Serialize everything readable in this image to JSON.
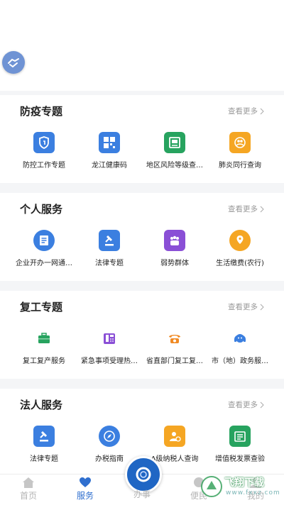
{
  "sections": [
    {
      "title": "防疫专题",
      "more": "查看更多",
      "items": [
        {
          "label": "防控工作专题",
          "icon": "shield-icon",
          "color": "#3b7fe0"
        },
        {
          "label": "龙江健康码",
          "icon": "qr-code-icon",
          "color": "#3b7fe0"
        },
        {
          "label": "地区风险等级查…",
          "icon": "document-icon",
          "color": "#27a35f"
        },
        {
          "label": "肺炎同行查询",
          "icon": "people-icon",
          "color": "#f5a623"
        }
      ]
    },
    {
      "title": "个人服务",
      "more": "查看更多",
      "items": [
        {
          "label": "企业开办一网通…",
          "icon": "form-icon",
          "color": "#3b7fe0"
        },
        {
          "label": "法律专题",
          "icon": "gavel-icon",
          "color": "#3b7fe0"
        },
        {
          "label": "弱势群体",
          "icon": "group-icon",
          "color": "#8a4fd6"
        },
        {
          "label": "生活缴费(农行)",
          "icon": "location-pin-icon",
          "color": "#f5a623"
        }
      ]
    },
    {
      "title": "复工专题",
      "more": "查看更多",
      "items": [
        {
          "label": "复工复产服务",
          "icon": "briefcase-icon",
          "color": "#27a35f"
        },
        {
          "label": "紧急事项受理热…",
          "icon": "fax-icon",
          "color": "#8a4fd6"
        },
        {
          "label": "省直部门复工复…",
          "icon": "telephone-icon",
          "color": "#f08a24"
        },
        {
          "label": "市（地）政务服…",
          "icon": "headset-icon",
          "color": "#3b7fe0"
        }
      ]
    },
    {
      "title": "法人服务",
      "more": "查看更多",
      "items": [
        {
          "label": "法律专题",
          "icon": "gavel-icon",
          "color": "#3b7fe0"
        },
        {
          "label": "办税指南",
          "icon": "compass-icon",
          "color": "#3b7fe0"
        },
        {
          "label": "A级纳税人查询",
          "icon": "taxpayer-icon",
          "color": "#f5a623"
        },
        {
          "label": "增值税发票查验",
          "icon": "invoice-icon",
          "color": "#27a35f"
        }
      ]
    }
  ],
  "tabbar": {
    "home": "首页",
    "services": "服务",
    "center": "办事",
    "convenience": "便民",
    "mine": "我的"
  },
  "watermark": {
    "text": "飞翔下载",
    "sub": "www.fxxz.com"
  },
  "colors": {
    "accent": "#2f6fcf",
    "inactive": "#b5b5b5"
  }
}
